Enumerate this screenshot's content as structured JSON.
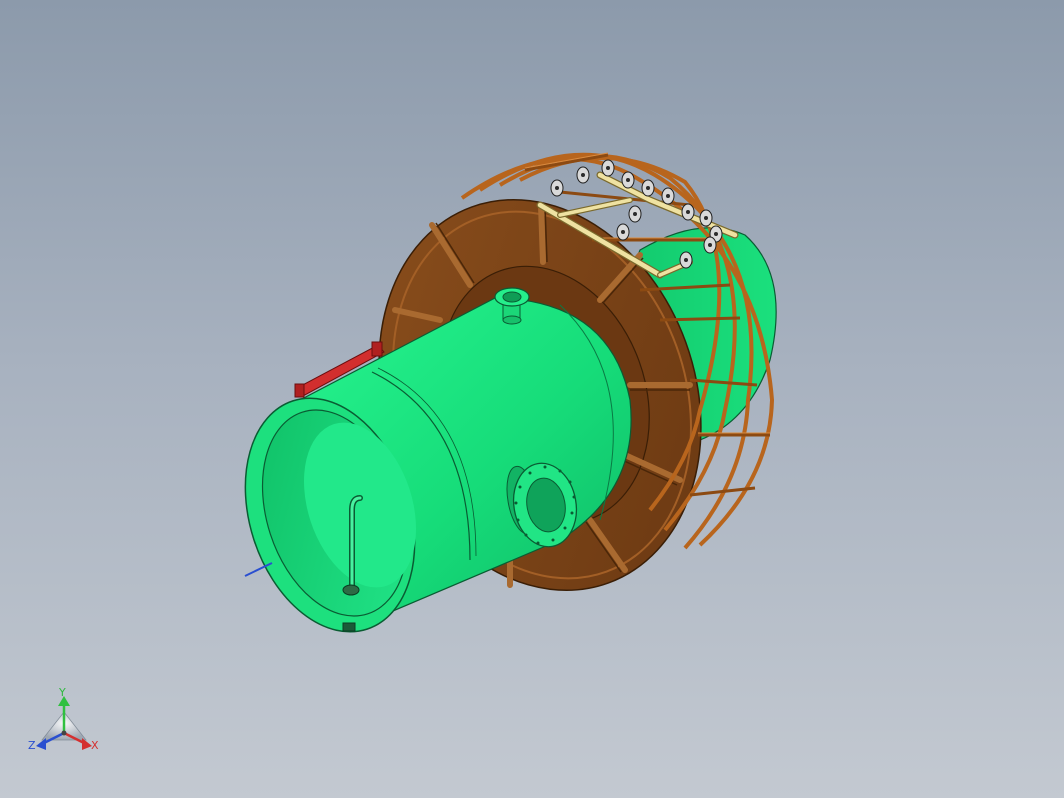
{
  "triad": {
    "x_label": "X",
    "y_label": "Y",
    "z_label": "Z"
  },
  "colors": {
    "background_top": "#8c9aab",
    "background_bottom": "#c3c9d1",
    "vessel_green": "#1ee882",
    "vessel_green_dark": "#0fa860",
    "flange_brown": "#7a4418",
    "flange_brown_dark": "#4a2608",
    "cage_orange": "#b8651d",
    "pipe_cream": "#efe2a2",
    "handle_red": "#cc2a2a",
    "axis_x": "#d43030",
    "axis_y": "#30c040",
    "axis_z": "#2a4fd0"
  }
}
